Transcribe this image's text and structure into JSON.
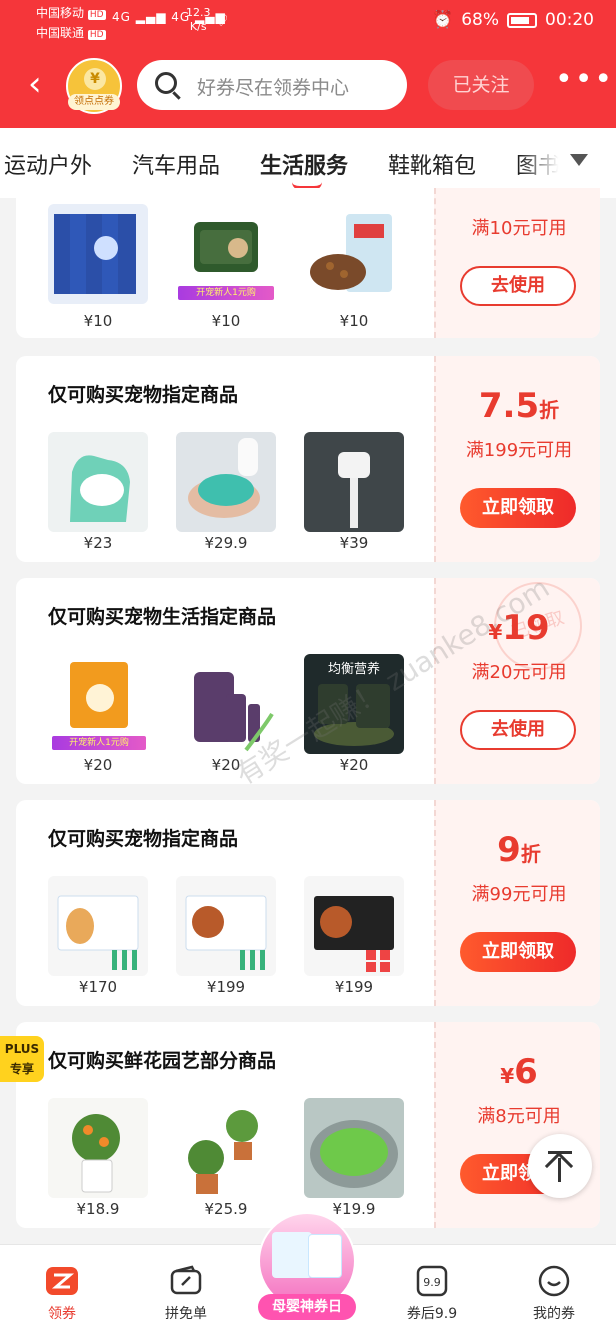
{
  "status_bar": {
    "carrier1": "中国移动",
    "carrier2": "中国联通",
    "hd": "HD",
    "net1": "4G",
    "net2": "4G",
    "speed_value": "12.3",
    "speed_unit": "K/s",
    "battery": "68%",
    "time": "00:20"
  },
  "header": {
    "avatar_tag": "领点点券",
    "search_placeholder": "好券尽在领券中心",
    "follow_label": "已关注",
    "more": "•••"
  },
  "tabs": [
    {
      "label": "运动户外"
    },
    {
      "label": "汽车用品"
    },
    {
      "label": "生活服务"
    },
    {
      "label": "鞋靴箱包"
    },
    {
      "label": "图书"
    }
  ],
  "cards": [
    {
      "products": [
        {
          "price": "¥10"
        },
        {
          "price": "¥10",
          "badge": "开宠新人1元购"
        },
        {
          "price": "¥10"
        }
      ],
      "condition": "满10元可用",
      "button": "去使用"
    },
    {
      "title": "仅可购买宠物指定商品",
      "products": [
        {
          "price": "¥23"
        },
        {
          "price": "¥29.9"
        },
        {
          "price": "¥39"
        }
      ],
      "amount": "7.5",
      "amount_unit": "折",
      "condition": "满199元可用",
      "button": "立即领取"
    },
    {
      "title": "仅可购买宠物生活指定商品",
      "products": [
        {
          "price": "¥20",
          "badge": "开宠新人1元购"
        },
        {
          "price": "¥20"
        },
        {
          "price": "¥20",
          "label": "均衡营养"
        }
      ],
      "currency": "¥",
      "amount": "19",
      "condition": "满20元可用",
      "button": "去使用",
      "stamp": "已领取"
    },
    {
      "title": "仅可购买宠物指定商品",
      "products": [
        {
          "price": "¥170"
        },
        {
          "price": "¥199"
        },
        {
          "price": "¥199"
        }
      ],
      "amount": "9",
      "amount_unit": "折",
      "condition": "满99元可用",
      "button": "立即领取"
    },
    {
      "title": "仅可购买鲜花园艺部分商品",
      "products": [
        {
          "price": "¥18.9"
        },
        {
          "price": "¥25.9"
        },
        {
          "price": "¥19.9"
        }
      ],
      "currency": "¥",
      "amount": "6",
      "condition": "满8元可用",
      "button": "立即领取"
    }
  ],
  "plus_badge": {
    "line1": "PLUS",
    "line2": "专享"
  },
  "watermark": "有奖一起赚！ zuanke8.com",
  "bottom_nav": [
    {
      "label": "领券",
      "icon": "coupon-icon",
      "active": true
    },
    {
      "label": "拼免单",
      "icon": "wallet-icon"
    },
    {
      "label": "母婴神券日",
      "icon": "mom-baby-promo"
    },
    {
      "label": "券后9.9",
      "icon": "nine-nine-icon"
    },
    {
      "label": "我的券",
      "icon": "smile-icon"
    }
  ],
  "colors": {
    "brand_red": "#f5363a",
    "coupon_red": "#e83b2f",
    "plus_yellow": "#ffd21e"
  }
}
